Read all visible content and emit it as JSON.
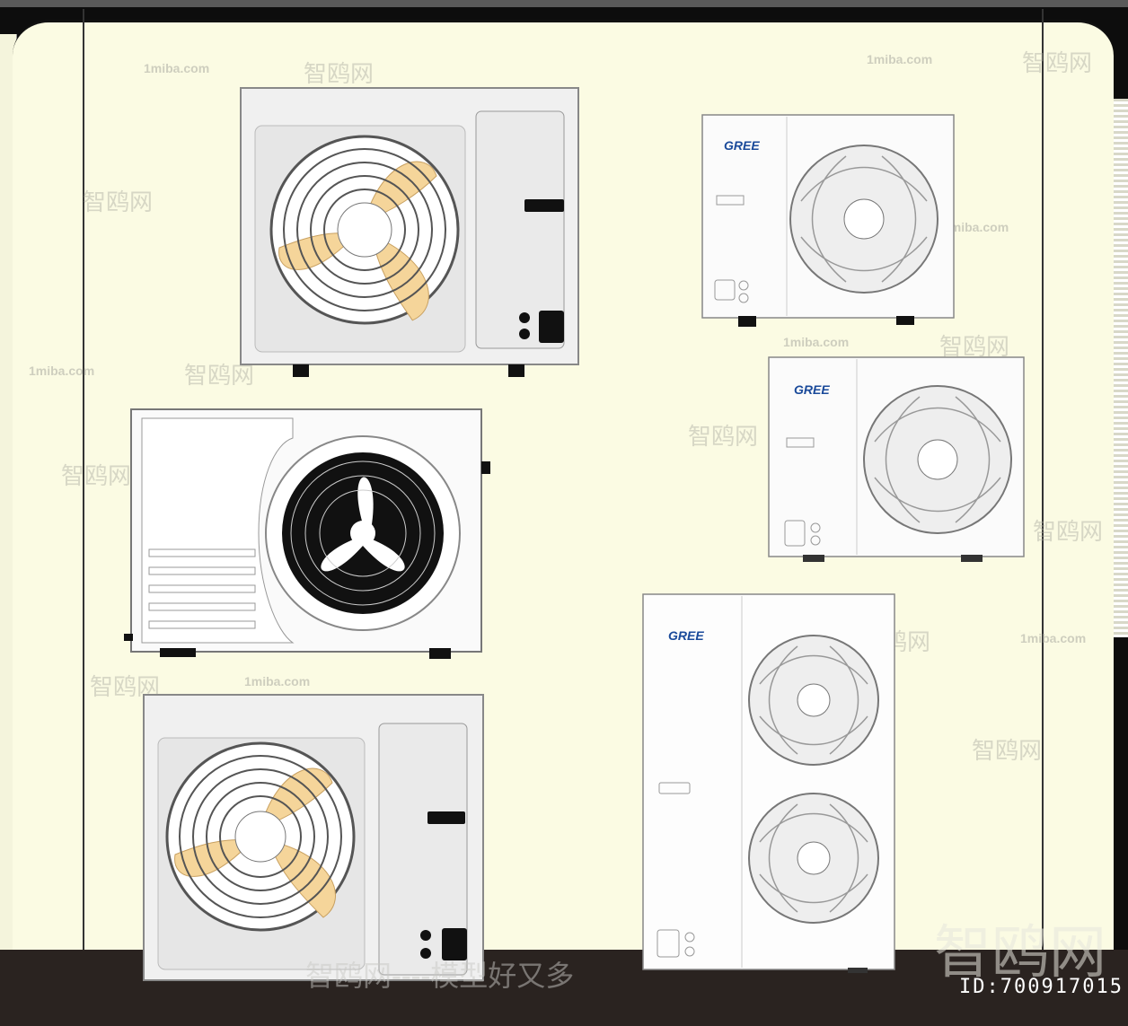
{
  "scene": {
    "watermark_site": "1miba.com",
    "watermark_cn": "智鸥网",
    "bottom_slogan": "智鸥网----模型好又多",
    "id_label": "ID:700917015"
  },
  "units": [
    {
      "id": "unit-1",
      "type": "outdoor-ac-yellow-fan",
      "brand": ""
    },
    {
      "id": "unit-2",
      "type": "outdoor-ac-black-fan",
      "brand": ""
    },
    {
      "id": "unit-3",
      "type": "outdoor-ac-yellow-fan",
      "brand": ""
    },
    {
      "id": "unit-4",
      "type": "gree-single-fan",
      "brand": "GREE"
    },
    {
      "id": "unit-5",
      "type": "gree-single-fan",
      "brand": "GREE"
    },
    {
      "id": "unit-6",
      "type": "gree-double-fan",
      "brand": "GREE"
    }
  ],
  "colors": {
    "wall": "#fbfbe3",
    "unit_body": "#f2f2f2",
    "fan_blade_yellow": "#f5d59a",
    "fan_black": "#1a1a1a",
    "gree_blue": "#1a4a9a"
  }
}
